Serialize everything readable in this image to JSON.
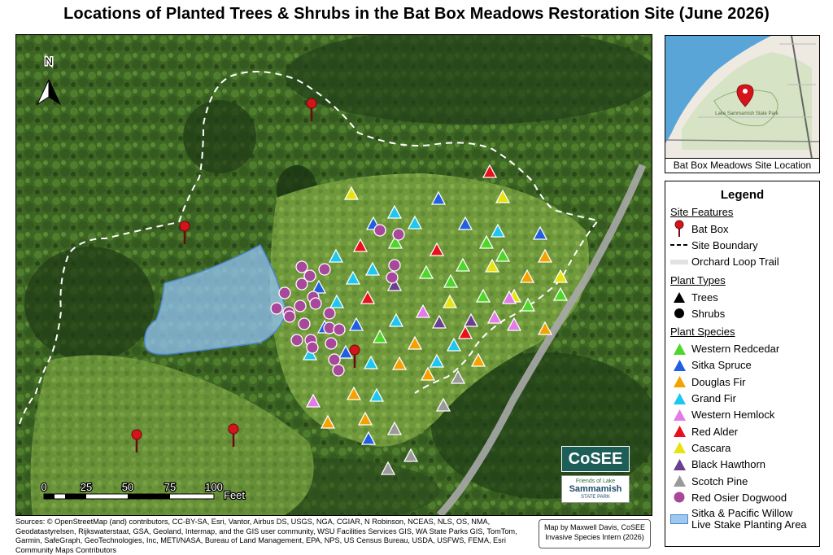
{
  "title": "Locations of Planted Trees & Shrubs in the Bat Box Meadows Restoration Site (June 2026)",
  "north_arrow": "N",
  "scale_bar": {
    "ticks": [
      "0",
      "25",
      "50",
      "75",
      "100"
    ],
    "unit": "Feet"
  },
  "inset": {
    "caption": "Bat Box Meadows Site Location",
    "park_label": "Lake Sammamish State Park"
  },
  "legend": {
    "title": "Legend",
    "site_features_heading": "Site Features",
    "site_features": [
      {
        "symbol": "bat-box-pin",
        "label": "Bat Box"
      },
      {
        "symbol": "dashed-line",
        "label": "Site Boundary"
      },
      {
        "symbol": "trail-line",
        "label": "Orchard Loop Trail"
      }
    ],
    "plant_types_heading": "Plant Types",
    "plant_types": [
      {
        "symbol": "triangle",
        "label": "Trees"
      },
      {
        "symbol": "circle",
        "label": "Shrubs"
      }
    ],
    "plant_species_heading": "Plant Species",
    "plant_species": [
      {
        "label": "Western Redcedar",
        "color": "#4fd62a",
        "shape": "triangle"
      },
      {
        "label": "Sitka Spruce",
        "color": "#1f5fe0",
        "shape": "triangle"
      },
      {
        "label": "Douglas Fir",
        "color": "#f5a200",
        "shape": "triangle"
      },
      {
        "label": "Grand Fir",
        "color": "#1fc6f0",
        "shape": "triangle"
      },
      {
        "label": "Western Hemlock",
        "color": "#e27ae8",
        "shape": "triangle"
      },
      {
        "label": "Red Alder",
        "color": "#e8101a",
        "shape": "triangle"
      },
      {
        "label": "Cascara",
        "color": "#e8e20e",
        "shape": "triangle"
      },
      {
        "label": "Black Hawthorn",
        "color": "#6b3f8f",
        "shape": "triangle"
      },
      {
        "label": "Scotch Pine",
        "color": "#9a9a9a",
        "shape": "triangle"
      },
      {
        "label": "Red Osier Dogwood",
        "color": "#a8489a",
        "shape": "circle"
      },
      {
        "label": "Sitka & Pacific Willow Live Stake Planting Area",
        "color": "#9ec8ef",
        "shape": "polygon"
      }
    ]
  },
  "logos": {
    "cosee": "CoSEE",
    "friends_small": "Friends of Lake",
    "friends_big": "Sammamish",
    "friends_state_park": "STATE PARK"
  },
  "credit": {
    "line1": "Map by Maxwell Davis, CoSEE",
    "line2": "Invasive Species Intern (2026)"
  },
  "sources": "Sources: © OpenStreetMap (and) contributors, CC-BY-SA, Esri, Vantor, Airbus DS, USGS, NGA, CGIAR, N Robinson, NCEAS, NLS, OS, NMA, Geodatastyrelsen, Rijkswaterstaat, GSA, Geoland, Intermap, and the GIS user community, WSU Facilities Services GIS, WA State Parks GIS, TomTom, Garmin, SafeGraph, GeoTechnologies, Inc, METI/NASA, Bureau of Land Management, EPA, NPS, US Census Bureau, USDA, USFWS, FEMA, Esri Community Maps Contributors",
  "colors": {
    "vegetation_dark": "#2c4a1c",
    "vegetation_mid": "#4f7a2c",
    "vegetation_light": "#7fa64a",
    "willow_area": "#8fc0ee",
    "trail": "#a9a9a9",
    "bat_box": "#d4141a"
  }
}
